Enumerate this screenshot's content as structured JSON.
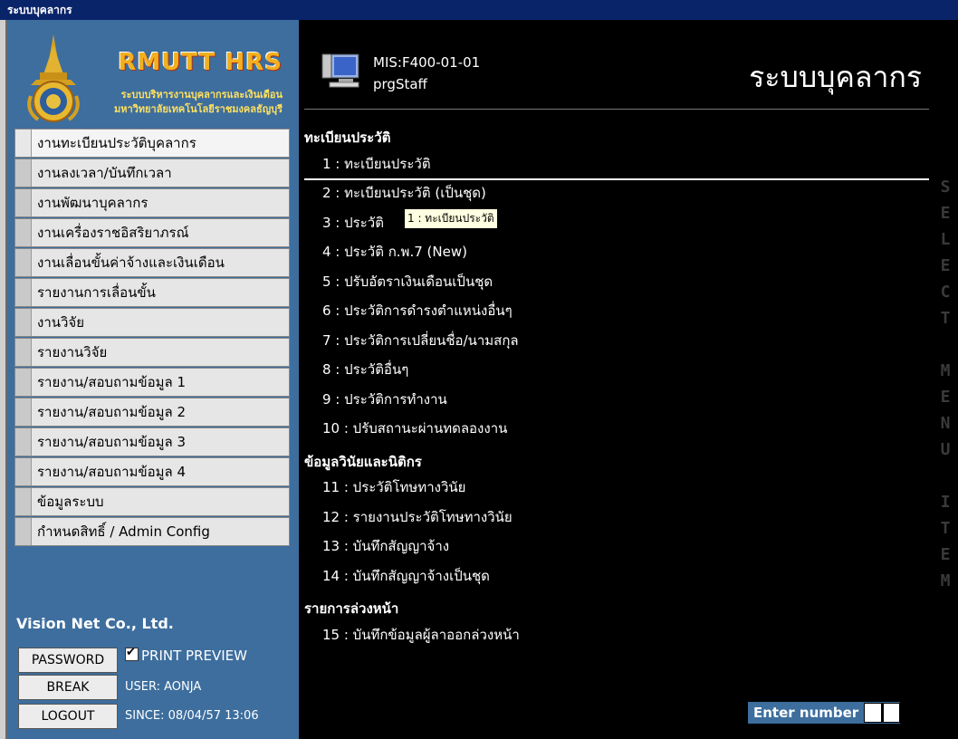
{
  "window": {
    "title": "ระบบบุคลากร"
  },
  "brand": {
    "title": "RMUTT HRS",
    "line1": "ระบบบริหารงานบุคลากรและเงินเดือน",
    "line2": "มหาวิทยาลัยเทคโนโลยีราชมงคลธัญบุรี"
  },
  "sidebar": {
    "items": [
      {
        "label": "งานทะเบียนประวัติบุคลากร",
        "active": true
      },
      {
        "label": "งานลงเวลา/บันทึกเวลา"
      },
      {
        "label": "งานพัฒนาบุคลากร"
      },
      {
        "label": "งานเครื่องราชอิสริยาภรณ์"
      },
      {
        "label": "งานเลื่อนขั้นค่าจ้างและเงินเดือน"
      },
      {
        "label": "รายงานการเลื่อนขั้น"
      },
      {
        "label": "งานวิจัย"
      },
      {
        "label": "รายงานวิจัย"
      },
      {
        "label": "รายงาน/สอบถามข้อมูล 1"
      },
      {
        "label": "รายงาน/สอบถามข้อมูล 2"
      },
      {
        "label": "รายงาน/สอบถามข้อมูล 3"
      },
      {
        "label": "รายงาน/สอบถามข้อมูล 4"
      },
      {
        "label": "ข้อมูลระบบ"
      },
      {
        "label": "กำหนดสิทธิ์ / Admin Config"
      }
    ],
    "company": "Vision Net Co., Ltd.",
    "password_label": "PASSWORD",
    "print_preview_label": "PRINT PREVIEW",
    "print_preview_checked": true,
    "break_label": "BREAK",
    "logout_label": "LOGOUT",
    "user_text": "USER: AONJA",
    "since_text": "SINCE: 08/04/57 13:06"
  },
  "header": {
    "form_code": "MIS:F400-01-01",
    "program": "prgStaff",
    "title": "ระบบบุคลากร"
  },
  "sections": [
    {
      "title": "ทะเบียนประวัติ",
      "items": [
        "1 : ทะเบียนประวัติ",
        "2 : ทะเบียนประวัติ (เป็นชุด)",
        "3 : ประวัติ",
        "4 : ประวัติ ก.พ.7 (New)",
        "5 : ปรับอัตราเงินเดือนเป็นชุด",
        "6 : ประวัติการดำรงตำแหน่งอื่นๆ",
        "7 : ประวัติการเปลี่ยนชื่อ/นามสกุล",
        "8 : ประวัติอื่นๆ",
        "9 : ประวัติการทำงาน",
        "10 : ปรับสถานะผ่านทดลองงาน"
      ]
    },
    {
      "title": "ข้อมูลวินัยและนิติกร",
      "items": [
        "11 : ประวัติโทษทางวินัย",
        "12 : รายงานประวัติโทษทางวินัย",
        "13 : บันทึกสัญญาจ้าง",
        "14 : บันทึกสัญญาจ้างเป็นชุด"
      ]
    },
    {
      "title": "รายการล่วงหน้า",
      "items": [
        "15 : บันทึกข้อมูลผู้ลาออกล่วงหน้า"
      ]
    }
  ],
  "tooltip": "1 : ทะเบียนประวัติ",
  "side_vertical_text": "SELECT MENU ITEM",
  "enter_number": {
    "label": "Enter number",
    "value": ""
  },
  "colors": {
    "sidebar_bg": "#3d6e9e",
    "main_bg": "#000000",
    "titlebar_bg": "#0a246a",
    "active_marker": "#f06020"
  }
}
